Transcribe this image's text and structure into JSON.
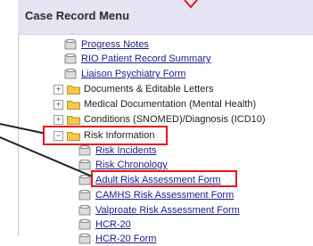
{
  "header": {
    "title": "Case Record Menu"
  },
  "tree": {
    "items": [
      {
        "label": "Progress Notes",
        "type": "document"
      },
      {
        "label": "RIO Patient Record Summary",
        "type": "document"
      },
      {
        "label": "Liaison Psychiatry Form",
        "type": "document"
      },
      {
        "label": "Documents & Editable Letters",
        "type": "folder",
        "expander": "+"
      },
      {
        "label": "Medical Documentation (Mental Health)",
        "type": "folder",
        "expander": "+"
      },
      {
        "label": "Conditions (SNOMED)/Diagnosis (ICD10)",
        "type": "folder",
        "expander": "+"
      },
      {
        "label": "Risk Information",
        "type": "folder",
        "expander": "−"
      },
      {
        "label": "Risk Incidents",
        "type": "document"
      },
      {
        "label": "Risk Chronology",
        "type": "document"
      },
      {
        "label": "Adult Risk Assessment Form",
        "type": "document"
      },
      {
        "label": "CAMHS Risk Assessment Form",
        "type": "document"
      },
      {
        "label": "Valproate Risk Assessment Form",
        "type": "document"
      },
      {
        "label": "HCR-20",
        "type": "document"
      },
      {
        "label": "HCR-20 Form",
        "type": "document"
      }
    ]
  },
  "colors": {
    "header_bg": "#e7e3f3",
    "highlight": "#e8141b",
    "link": "#1a1a8c",
    "folder": "#f2c94c"
  }
}
